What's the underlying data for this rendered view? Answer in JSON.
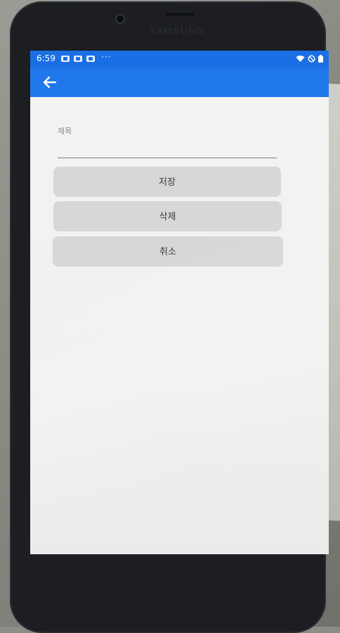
{
  "status_bar": {
    "time": "6:59",
    "more": "···",
    "accent": "#1a6fe6"
  },
  "app_bar": {
    "color": "#2178ea",
    "back_icon": "arrow-left-icon"
  },
  "form": {
    "title_label": "제목",
    "title_value": ""
  },
  "buttons": {
    "save_label": "저장",
    "delete_label": "삭제",
    "cancel_label": "취소"
  },
  "device": {
    "brand": "SAMSUNG"
  }
}
